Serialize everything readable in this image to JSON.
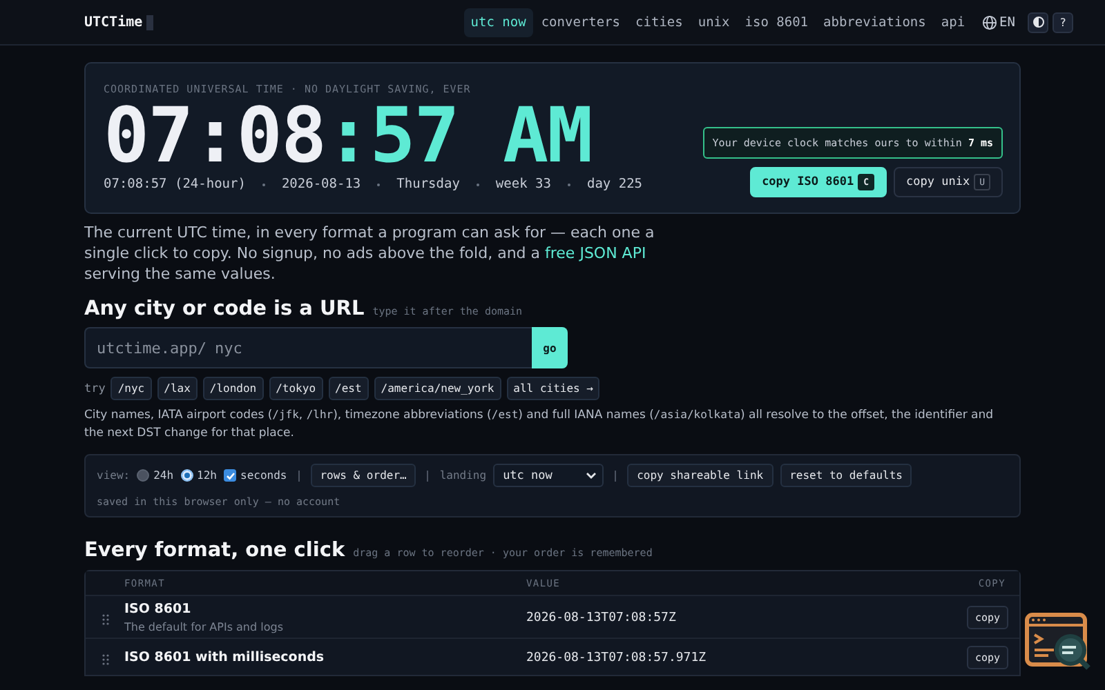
{
  "header": {
    "logo": "UTCTime",
    "nav": [
      {
        "label": "utc now",
        "selected": true
      },
      {
        "label": "converters",
        "selected": false
      },
      {
        "label": "cities",
        "selected": false
      },
      {
        "label": "unix",
        "selected": false
      },
      {
        "label": "iso 8601",
        "selected": false
      },
      {
        "label": "abbreviations",
        "selected": false
      },
      {
        "label": "api",
        "selected": false
      }
    ],
    "language": "EN",
    "help": "?"
  },
  "hero": {
    "label": "COORDINATED UNIVERSAL TIME · NO DAYLIGHT SAVING, EVER",
    "time_main": "07:08",
    "time_accent": ":57 AM",
    "details": [
      "07:08:57 (24-hour)",
      "2026-08-13",
      "Thursday",
      "week 33",
      "day 225"
    ],
    "sync_note": "Your device clock matches ours to within **7 ms**",
    "buttons": [
      {
        "label": "copy ISO 8601",
        "key": "C",
        "kind": "primary"
      },
      {
        "label": "copy unix",
        "key": "U",
        "kind": "secondary"
      }
    ]
  },
  "intro": {
    "before": "The current UTC time, in every format a program can ask for — each one a single click to copy. No signup, no ads above the fold, and a ",
    "link": "free JSON API",
    "after": " serving the same values."
  },
  "url_section": {
    "title": "Any city or code is a URL",
    "hint": "type it after the domain",
    "prefix": "utctime.app/",
    "placeholder": "nyc",
    "go": "go",
    "try_label": "try",
    "chips": [
      "/nyc",
      "/lax",
      "/london",
      "/tokyo",
      "/est",
      "/america/new_york",
      "all cities →"
    ],
    "note": [
      {
        "text": "City names, IATA airport codes (",
        "code": false
      },
      {
        "text": "/jfk",
        "code": true
      },
      {
        "text": ", ",
        "code": false
      },
      {
        "text": "/lhr",
        "code": true
      },
      {
        "text": "), timezone abbreviations (",
        "code": false
      },
      {
        "text": "/est",
        "code": true
      },
      {
        "text": ") and full IANA names (",
        "code": false
      },
      {
        "text": "/asia/kolkata",
        "code": true
      },
      {
        "text": ") all resolve to the offset, the identifier and the next DST change for that place.",
        "code": false
      }
    ]
  },
  "settings": {
    "view_label": "view:",
    "radios": [
      {
        "label": "24h",
        "selected": false
      },
      {
        "label": "12h",
        "selected": true
      }
    ],
    "checkbox": {
      "label": "seconds",
      "checked": true
    },
    "rows_button": "rows & order…",
    "landing_label": "landing",
    "landing_value": "utc now",
    "buttons": [
      "copy shareable link",
      "reset to defaults"
    ],
    "note": "saved in this browser only — no account"
  },
  "formats": {
    "title": "Every format, one click",
    "hint": "drag a row to reorder · your order is remembered",
    "columns": [
      "FORMAT",
      "VALUE",
      "COPY"
    ],
    "rows": [
      {
        "name": "ISO 8601",
        "description": "The default for APIs and logs",
        "value": "2026-08-13T07:08:57Z",
        "copy": "copy"
      },
      {
        "name": "ISO 8601 with milliseconds",
        "value": "2026-08-13T07:08:57.971Z",
        "copy": "copy"
      }
    ]
  }
}
